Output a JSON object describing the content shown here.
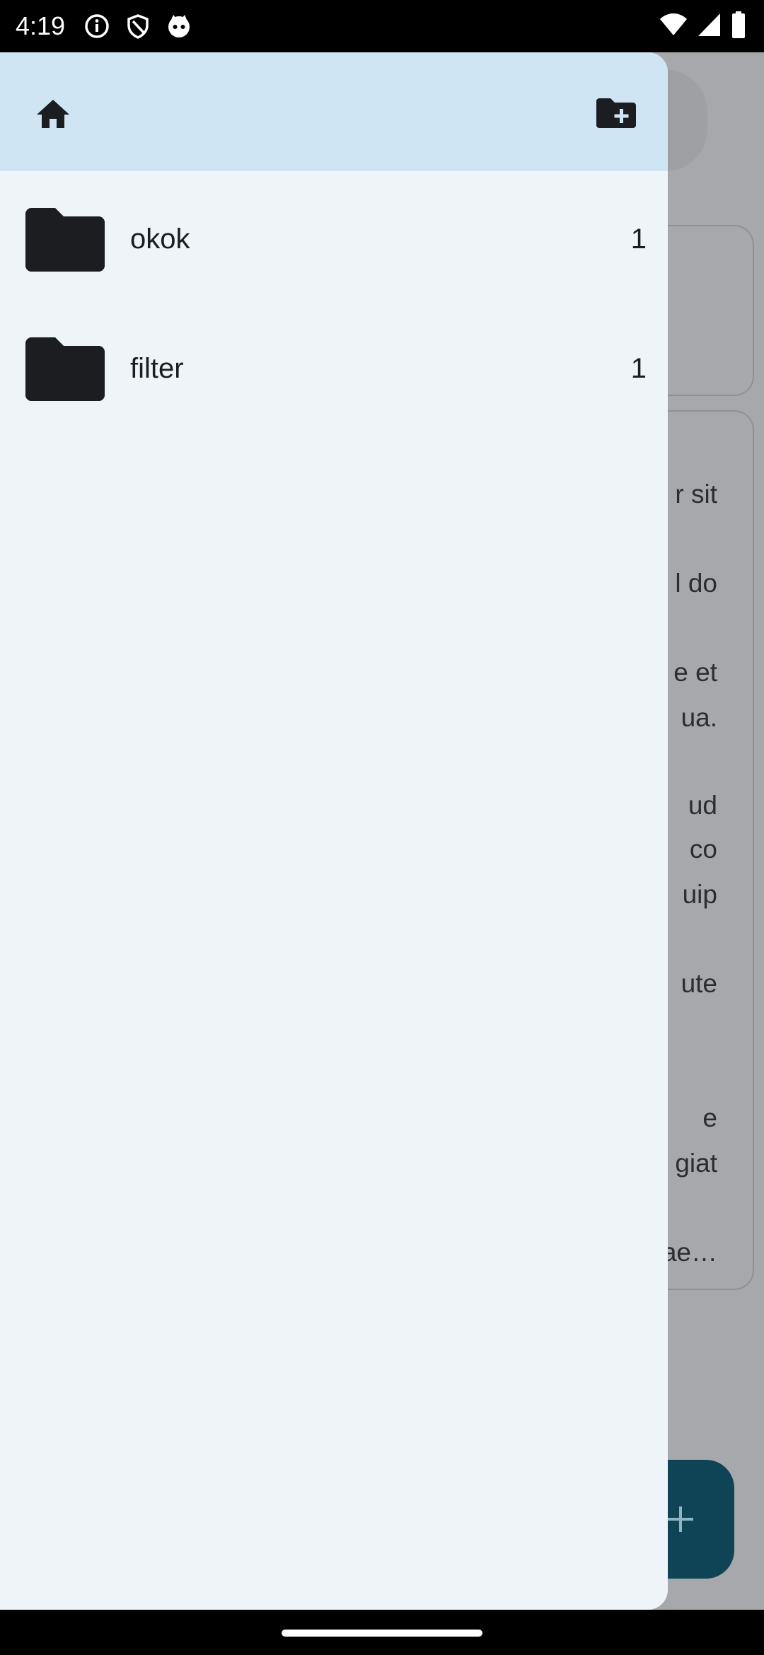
{
  "status_bar": {
    "time": "4:19",
    "left_icons": [
      "info-icon",
      "shield-icon",
      "cat-face-icon"
    ],
    "right_icons": [
      "wifi-icon",
      "cellular-signal-icon",
      "battery-icon"
    ]
  },
  "background_app": {
    "card_text_fragments": [
      "r sit",
      "l do",
      "e et",
      "ua.",
      "ud",
      "co",
      "uip",
      "ute",
      "e",
      "giat",
      "ae…"
    ],
    "fab_icon": "plus-icon",
    "fab_color": "#0f4356"
  },
  "drawer": {
    "header_bg": "#d0e5f4",
    "home_icon": "home-icon",
    "new_folder_icon": "create-new-folder-icon",
    "folders": [
      {
        "name": "okok",
        "count": "1",
        "icon": "folder-icon"
      },
      {
        "name": "filter",
        "count": "1",
        "icon": "folder-icon"
      }
    ]
  }
}
